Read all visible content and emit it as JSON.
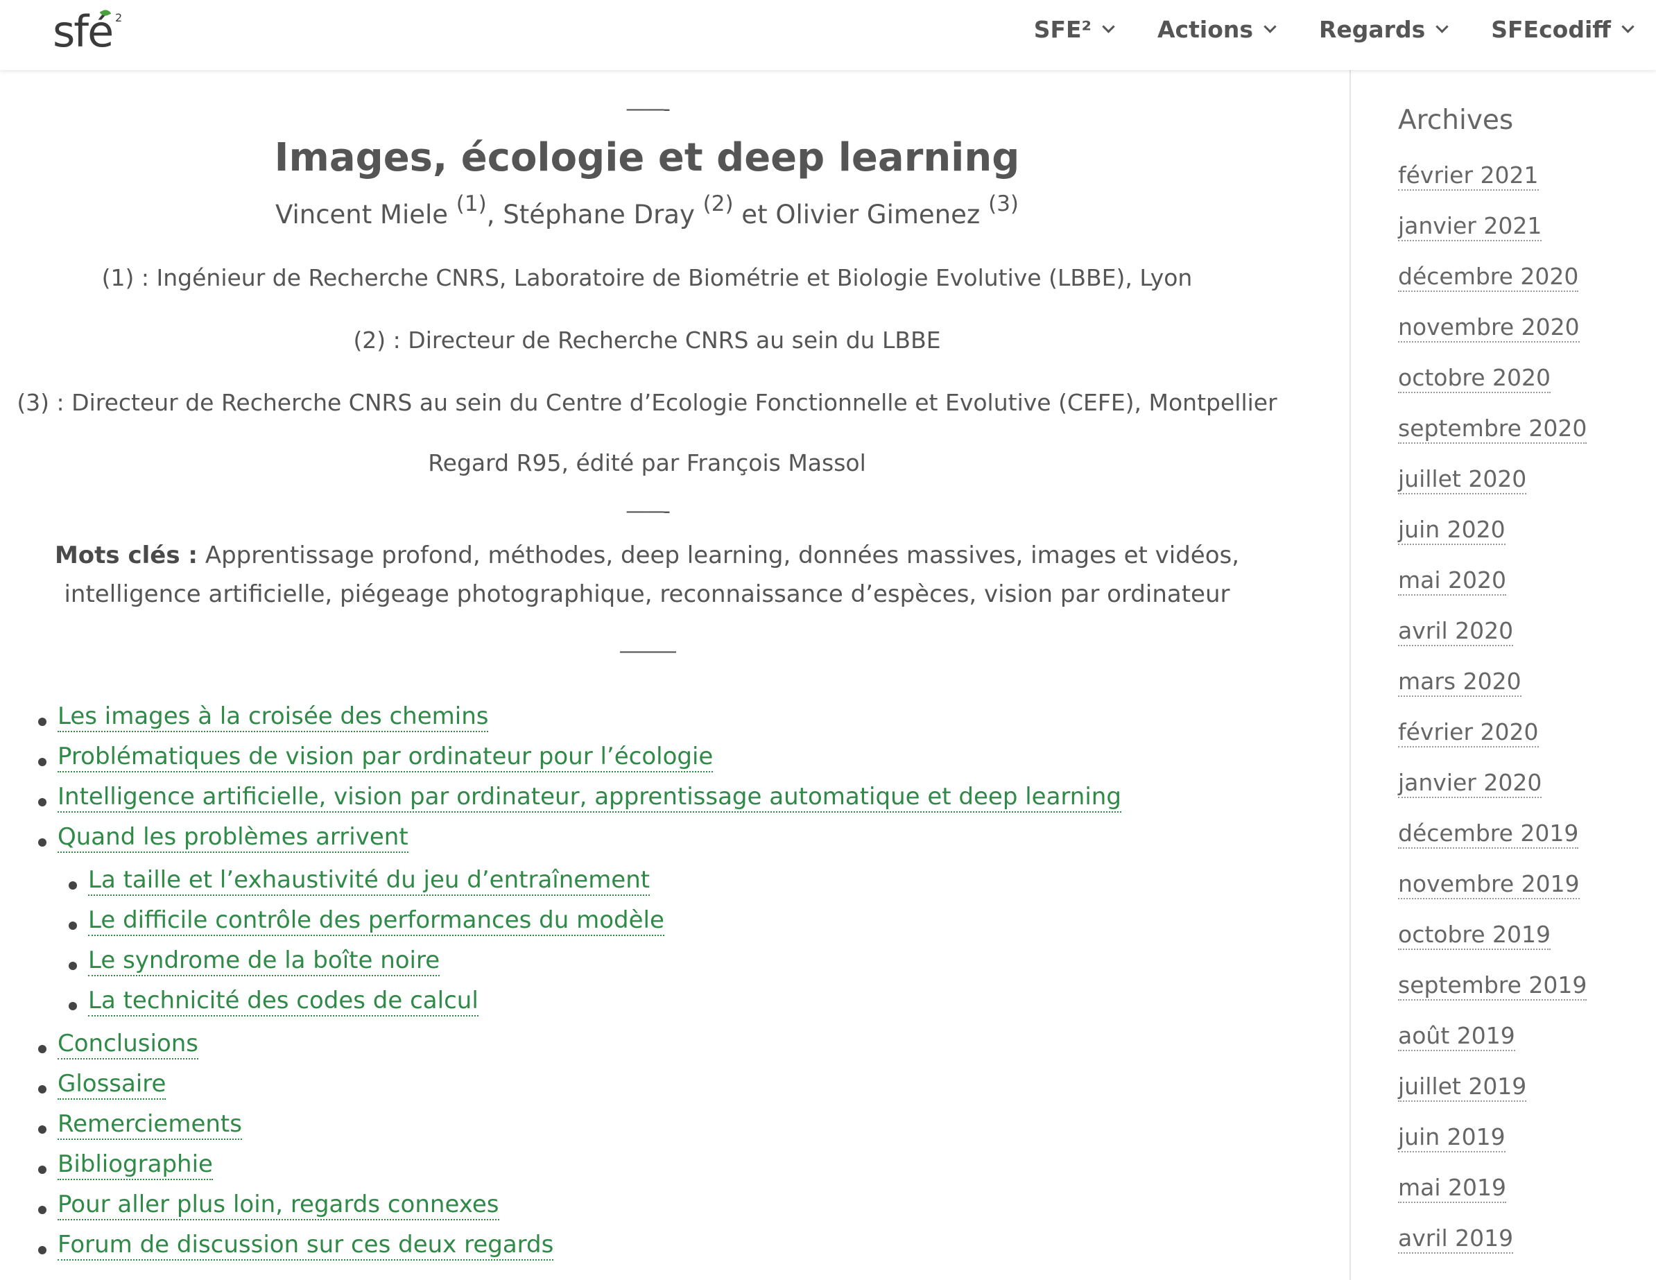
{
  "header": {
    "logo_text": "sfé",
    "logo_sup": "2",
    "nav": [
      {
        "label": "SFE²"
      },
      {
        "label": "Actions"
      },
      {
        "label": "Regards"
      },
      {
        "label": "SFEcodiff"
      }
    ]
  },
  "article": {
    "separator": "——-",
    "separator2": "——-",
    "separator3": "———",
    "title": "Images, écologie et deep learning",
    "authors": {
      "a1": "Vincent Miele ",
      "s1": "(1)",
      "a2": ", Stéphane Dray ",
      "s2": "(2)",
      "a3": " et Olivier Gimenez ",
      "s3": "(3)"
    },
    "affiliations": [
      "(1) : Ingénieur de Recherche CNRS, Laboratoire de Biométrie et Biologie Evolutive (LBBE), Lyon",
      "(2) : Directeur de Recherche CNRS au sein du LBBE",
      "(3) : Directeur de Recherche CNRS au sein du Centre d’Ecologie Fonctionnelle et Evolutive (CEFE), Montpellier"
    ],
    "editor": "Regard R95, édité par François Massol",
    "keywords_label": "Mots clés :",
    "keywords_text": " Apprentissage profond, méthodes, deep learning, données massives, images et vidéos, intelligence artificielle, piégeage photographique, reconnaissance d’espèces, vision par ordinateur",
    "toc": [
      "Les images à la croisée des chemins",
      "Problématiques de vision par ordinateur pour l’écologie",
      "Intelligence artificielle, vision par ordinateur, apprentissage automatique et deep learning",
      "Quand les problèmes arrivent",
      "La taille et l’exhaustivité du jeu d’entraînement",
      "Le difficile contrôle des performances du modèle",
      "Le syndrome de la boîte noire",
      "La technicité des codes de calcul",
      "Conclusions",
      "Glossaire",
      "Remerciements",
      "Bibliographie",
      "Pour aller plus loin, regards connexes",
      "Forum de discussion sur ces deux regards"
    ]
  },
  "sidebar": {
    "title": "Archives",
    "items": [
      "février 2021",
      "janvier 2021",
      "décembre 2020",
      "novembre 2020",
      "octobre 2020",
      "septembre 2020",
      "juillet 2020",
      "juin 2020",
      "mai 2020",
      "avril 2020",
      "mars 2020",
      "février 2020",
      "janvier 2020",
      "décembre 2019",
      "novembre 2019",
      "octobre 2019",
      "septembre 2019",
      "août 2019",
      "juillet 2019",
      "juin 2019",
      "mai 2019",
      "avril 2019"
    ]
  },
  "colors": {
    "link": "#2f8a47",
    "text": "#555555",
    "logo_leaf": "#4aa03f"
  }
}
